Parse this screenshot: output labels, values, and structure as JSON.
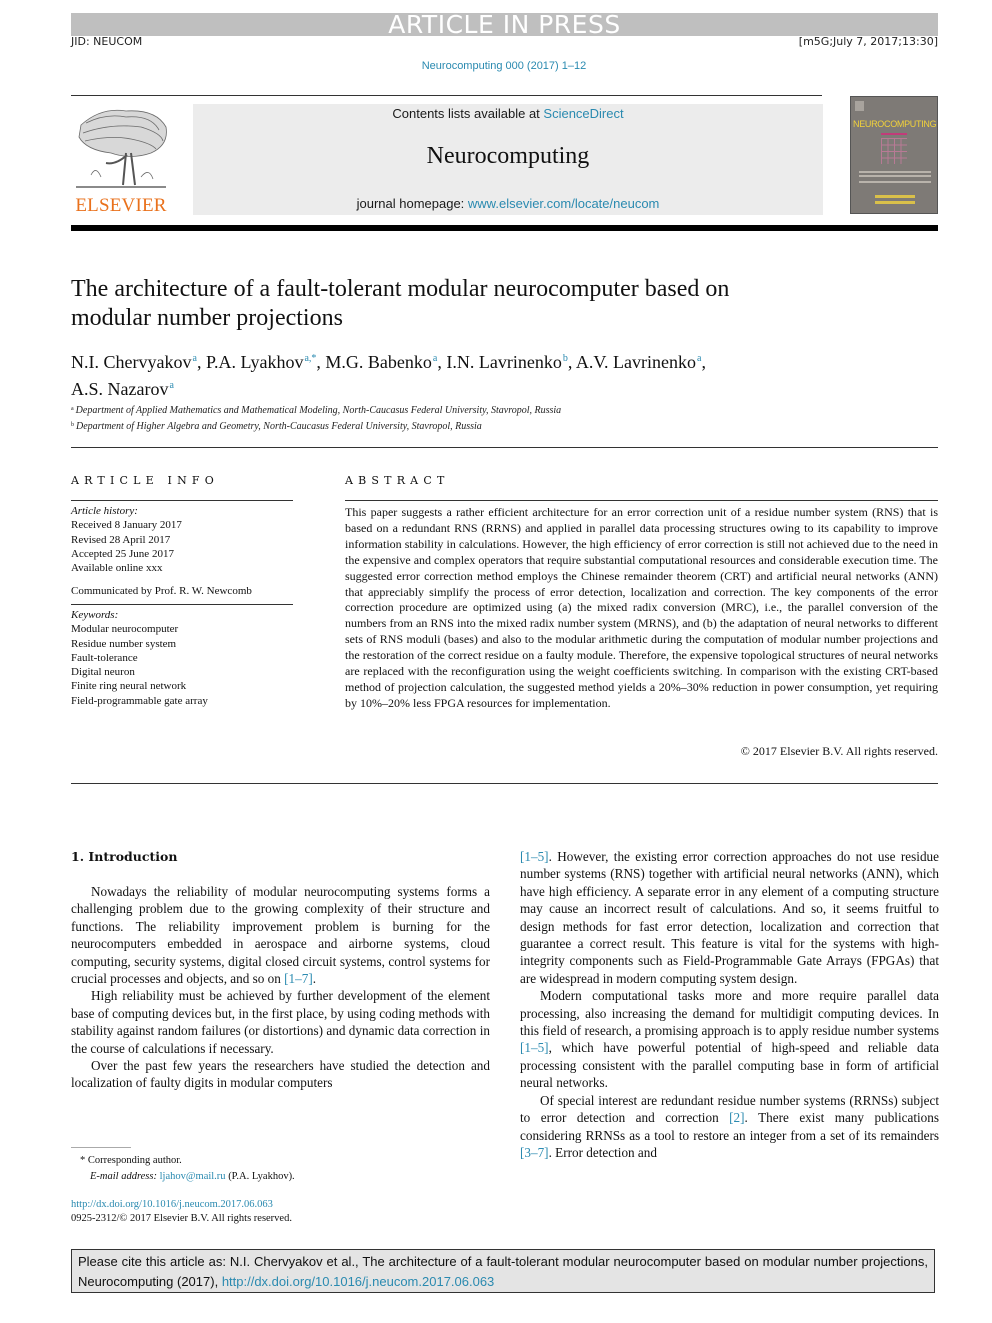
{
  "banner": {
    "status": "ARTICLE IN PRESS",
    "jid": "JID: NEUCOM",
    "stamp": "[m5G;July 7, 2017;13:30]",
    "journal_ref": "Neurocomputing 000 (2017) 1–12"
  },
  "header": {
    "publisher_logo_text": "ELSEVIER",
    "contents_prefix": "Contents lists available at ",
    "contents_link": "ScienceDirect",
    "journal_name": "Neurocomputing",
    "homepage_prefix": "journal homepage: ",
    "homepage_link": "www.elsevier.com/locate/neucom",
    "cover_title": "NEUROCOMPUTING"
  },
  "article": {
    "title_line1": "The architecture of a fault-tolerant modular neurocomputer based on",
    "title_line2": "modular number projections",
    "authors": [
      {
        "name": "N.I. Chervyakov",
        "affil": "a"
      },
      {
        "name": "P.A. Lyakhov",
        "affil": "a,*"
      },
      {
        "name": "M.G. Babenko",
        "affil": "a"
      },
      {
        "name": "I.N. Lavrinenko",
        "affil": "b"
      },
      {
        "name": "A.V. Lavrinenko",
        "affil": "a"
      },
      {
        "name": "A.S. Nazarov",
        "affil": "a"
      }
    ],
    "affiliations": [
      {
        "key": "a",
        "text": "Department of Applied Mathematics and Mathematical Modeling, North-Caucasus Federal University, Stavropol, Russia"
      },
      {
        "key": "b",
        "text": "Department of Higher Algebra and Geometry, North-Caucasus Federal University, Stavropol, Russia"
      }
    ]
  },
  "article_info": {
    "heading": "ARTICLE INFO",
    "history_label": "Article history:",
    "history": [
      "Received 8 January 2017",
      "Revised 28 April 2017",
      "Accepted 25 June 2017",
      "Available online xxx"
    ],
    "communicated": "Communicated by Prof. R. W. Newcomb",
    "keywords_label": "Keywords:",
    "keywords": [
      "Modular neurocomputer",
      "Residue number system",
      "Fault-tolerance",
      "Digital neuron",
      "Finite ring neural network",
      "Field-programmable gate array"
    ]
  },
  "abstract": {
    "heading": "ABSTRACT",
    "text": "This paper suggests a rather efficient architecture for an error correction unit of a residue number system (RNS) that is based on a redundant RNS (RRNS) and applied in parallel data processing structures owing to its capability to improve information stability in calculations. However, the high efficiency of error correction is still not achieved due to the need in the expensive and complex operators that require substantial computational resources and considerable execution time. The suggested error correction method employs the Chinese remainder theorem (CRT) and artificial neural networks (ANN) that appreciably simplify the process of error detection, localization and correction. The key components of the error correction procedure are optimized using (a) the mixed radix conversion (MRC), i.e., the parallel conversion of the numbers from an RNS into the mixed radix number system (MRNS), and (b) the adaptation of neural networks to different sets of RNS moduli (bases) and also to the modular arithmetic during the computation of modular number projections and the restoration of the correct residue on a faulty module. Therefore, the expensive topological structures of neural networks are replaced with the reconfiguration using the weight coefficients switching. In comparison with the existing CRT-based method of projection calculation, the suggested method yields a 20%–30% reduction in power consumption, yet requiring by 10%–20% less FPGA resources for implementation.",
    "copyright": "© 2017 Elsevier B.V. All rights reserved."
  },
  "body": {
    "section_heading": "1. Introduction",
    "left": {
      "p1": "Nowadays the reliability of modular neurocomputing systems forms a challenging problem due to the growing complexity of their structure and functions. The reliability improvement problem is burning for the neurocomputers embedded in aerospace and airborne systems, cloud computing, security systems, digital closed circuit systems, control systems for crucial processes and objects, and so on ",
      "p1_ref": "[1–7]",
      "p1_end": ".",
      "p2": "High reliability must be achieved by further development of the element base of computing devices but, in the first place, by using coding methods with stability against random failures (or distortions) and dynamic data correction in the course of calculations if necessary.",
      "p3": "Over the past few years the researchers have studied the detection and localization of faulty digits in modular computers"
    },
    "right": {
      "p0_ref": "[1–5]",
      "p0": ". However, the existing error correction approaches do not use residue number systems (RNS) together with artificial neural networks (ANN), which have high efficiency. A separate error in any element of a computing structure may cause an incorrect result of calculations. And so, it seems fruitful to design methods for fast error detection, localization and correction that guarantee a correct result. This feature is vital for the systems with high-integrity components such as Field-Programmable Gate Arrays (FPGAs) that are widespread in modern computing system design.",
      "p1a": "Modern computational tasks more and more require parallel data processing, also increasing the demand for multidigit computing devices. In this field of research, a promising approach is to apply residue number systems ",
      "p1_ref": "[1–5]",
      "p1b": ", which have powerful potential of high-speed and reliable data processing consistent with the parallel computing base in form of artificial neural networks.",
      "p2a": "Of special interest are redundant residue number systems (RRNSs) subject to error detection and correction ",
      "p2_ref1": "[2]",
      "p2b": ". There exist many publications considering RRNSs as a tool to restore an integer from a set of its remainders ",
      "p2_ref2": "[3–7]",
      "p2c": ". Error detection and"
    }
  },
  "footnotes": {
    "corresponding_mark": "*",
    "corresponding": "Corresponding author.",
    "email_label": "E-mail address: ",
    "email": "ljahov@mail.ru",
    "email_owner": " (P.A. Lyakhov).",
    "doi": "http://dx.doi.org/10.1016/j.neucom.2017.06.063",
    "issn": "0925-2312/© 2017 Elsevier B.V. All rights reserved."
  },
  "cite_box": {
    "text": "Please cite this article as: N.I. Chervyakov et al., The architecture of a fault-tolerant modular neurocomputer based on modular number projections, Neurocomputing (2017), ",
    "doi": "http://dx.doi.org/10.1016/j.neucom.2017.06.063"
  }
}
